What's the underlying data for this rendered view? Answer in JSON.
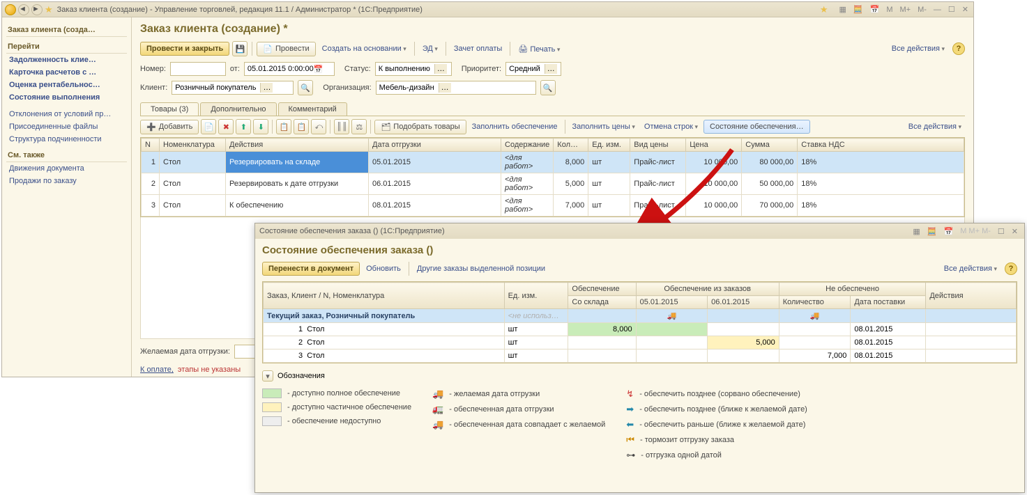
{
  "window": {
    "title": "Заказ клиента (создание) - Управление торговлей, редакция 11.1 / Администратор * (1С:Предприятие)",
    "right_btns": [
      "M",
      "M+",
      "M-"
    ]
  },
  "sidebar": {
    "section1_title": "Заказ клиента (созда…",
    "go_title": "Перейти",
    "go_links": [
      "Задолженность клие…",
      "Карточка расчетов с …",
      "Оценка рентабельнос…",
      "Состояние выполнения"
    ],
    "misc_links": [
      "Отклонения от условий пр…",
      "Присоединенные файлы",
      "Структура подчиненности"
    ],
    "see_also_title": "См. также",
    "see_also_links": [
      "Движения документа",
      "Продажи по заказу"
    ]
  },
  "form": {
    "title": "Заказ клиента (создание) *",
    "main_btn": "Провести и закрыть",
    "provesti": "Провести",
    "create_based": "Создать на основании",
    "ed": "ЭД",
    "offset": "Зачет оплаты",
    "print": "Печать",
    "all_actions": "Все действия",
    "number_label": "Номер:",
    "number": "",
    "from_label": "от:",
    "date": "05.01.2015 0:00:00",
    "status_label": "Статус:",
    "status": "К выполнению",
    "priority_label": "Приоритет:",
    "priority": "Средний",
    "client_label": "Клиент:",
    "client": "Розничный покупатель",
    "org_label": "Организация:",
    "org": "Мебель-дизайн"
  },
  "tabs": {
    "t1": "Товары (3)",
    "t2": "Дополнительно",
    "t3": "Комментарий"
  },
  "goods_toolbar": {
    "add": "Добавить",
    "pick": "Подобрать товары",
    "fill_supply": "Заполнить обеспечение",
    "fill_prices": "Заполнить цены",
    "cancel_rows": "Отмена строк",
    "supply_state": "Состояние обеспечения…",
    "all_actions": "Все действия"
  },
  "cols": {
    "n": "N",
    "nom": "Номенклатура",
    "act": "Действия",
    "ship": "Дата отгрузки",
    "cont": "Содержание",
    "qty": "Кол…",
    "unit": "Ед. изм.",
    "ptype": "Вид цены",
    "price": "Цена",
    "sum": "Сумма",
    "vat": "Ставка НДС"
  },
  "rows": [
    {
      "n": "1",
      "nom": "Стол",
      "act": "Резервировать на складе",
      "ship": "05.01.2015",
      "cont": "<для работ>",
      "qty": "8,000",
      "unit": "шт",
      "ptype": "Прайс-лист",
      "price": "10 000,00",
      "sum": "80 000,00",
      "vat": "18%"
    },
    {
      "n": "2",
      "nom": "Стол",
      "act": "Резервировать к дате отгрузки",
      "ship": "06.01.2015",
      "cont": "<для работ>",
      "qty": "5,000",
      "unit": "шт",
      "ptype": "Прайс-лист",
      "price": "10 000,00",
      "sum": "50 000,00",
      "vat": "18%"
    },
    {
      "n": "3",
      "nom": "Стол",
      "act": "К обеспечению",
      "ship": "08.01.2015",
      "cont": "<для работ>",
      "qty": "7,000",
      "unit": "шт",
      "ptype": "Прайс-лист",
      "price": "10 000,00",
      "sum": "70 000,00",
      "vat": "18%"
    }
  ],
  "footer": {
    "desired_label": "Желаемая дата отгрузки:",
    "desired": "",
    "pay_link": "К оплате,",
    "pay_text": "этапы не указаны"
  },
  "modal": {
    "wtitle": "Состояние обеспечения заказа () (1С:Предприятие)",
    "title": "Состояние обеспечения заказа ()",
    "move_btn": "Перенести в документ",
    "refresh": "Обновить",
    "other": "Другие заказы выделенной позиции",
    "all_actions": "Все действия",
    "th": {
      "order": "Заказ, Клиент / N, Номенклатура",
      "unit": "Ед. изм.",
      "supply": "Обеспечение",
      "from_orders": "Обеспечение из заказов",
      "not_supplied": "Не обеспечено",
      "act": "Действия",
      "from_stock": "Со склада",
      "d1": "05.01.2015",
      "d2": "06.01.2015",
      "qty": "Количество",
      "delivery": "Дата поставки"
    },
    "group_row": "Текущий заказ, Розничный покупатель",
    "group_unit": "<не использ…",
    "rows": [
      {
        "n": "1",
        "nom": "Стол",
        "unit": "шт",
        "stock": "8,000",
        "d1": "",
        "d2": "",
        "qty": "",
        "del": "08.01.2015",
        "css": "full"
      },
      {
        "n": "2",
        "nom": "Стол",
        "unit": "шт",
        "stock": "",
        "d1": "",
        "d2": "5,000",
        "qty": "",
        "del": "08.01.2015",
        "css": "part"
      },
      {
        "n": "3",
        "nom": "Стол",
        "unit": "шт",
        "stock": "",
        "d1": "",
        "d2": "",
        "qty": "7,000",
        "del": "08.01.2015",
        "css": ""
      }
    ],
    "legend_label": "Обозначения",
    "legend": {
      "l1": "- доступно полное обеспечение",
      "l2": "- доступно частичное обеспечение",
      "l3": "- обеспечение недоступно",
      "l4": "- желаемая дата отгрузки",
      "l5": "- обеспеченная дата отгрузки",
      "l6": "- обеспеченная дата совпадает с желаемой",
      "l7": "- обеспечить позднее (сорвано обеспечение)",
      "l8": "- обеспечить позднее (ближе к желаемой дате)",
      "l9": "- обеспечить раньше (ближе к желаемой дате)",
      "l10": "- тормозит отгрузку заказа",
      "l11": "- отгрузка одной датой"
    }
  }
}
